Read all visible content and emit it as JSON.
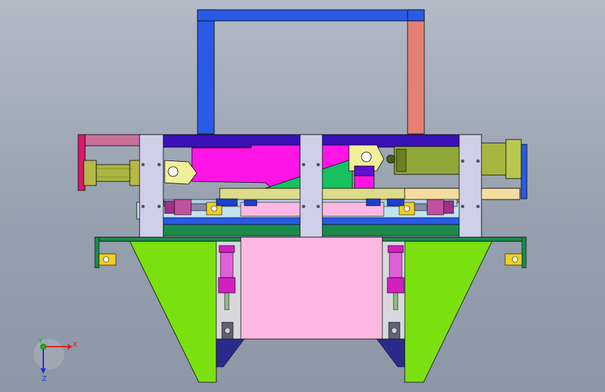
{
  "viewport": {
    "background_top": "#b2bac6",
    "background_bottom": "#8c96a5"
  },
  "triad": {
    "x_label": "X",
    "y_label": "Y",
    "z_label": "Z",
    "x_color": "#e02020",
    "y_color": "#20b020",
    "z_color": "#2030d0"
  },
  "colors": {
    "frame_blue": "#2a5ae6",
    "frame_salmon": "#e58075",
    "plate_lavender": "#cfcfea",
    "base_green": "#7be010",
    "deck_green": "#1c8a4a",
    "magenta": "#ff14e6",
    "pink": "#ffb8e2",
    "cylinder_olive": "#a7b640",
    "beam_yellow": "#dcdc8a",
    "top_purple": "#3a10b8"
  }
}
